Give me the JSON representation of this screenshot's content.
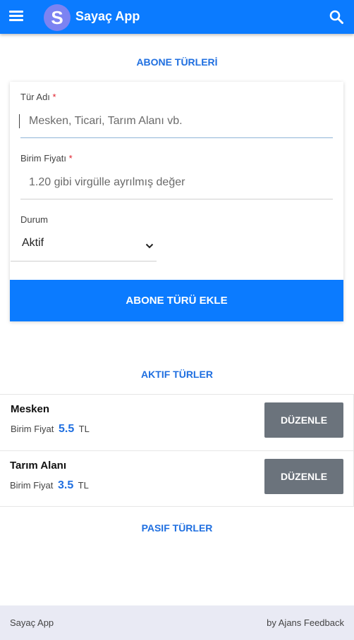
{
  "appbar": {
    "title": "Sayaç App",
    "logo_letter": "S",
    "menu_icon": "hamburger-menu-icon",
    "search_icon": "search-icon",
    "background": "#0b7bff"
  },
  "subscriber_types": {
    "heading": "ABONE TÜRLERİ"
  },
  "form": {
    "type_name": {
      "label": "Tür Adı",
      "required_mark": "*",
      "value": "",
      "placeholder": "Mesken, Ticari, Tarım Alanı vb."
    },
    "unit_price": {
      "label": "Birim Fiyatı",
      "required_mark": "*",
      "value": "",
      "placeholder": "1.20 gibi virgülle ayrılmış değer"
    },
    "status": {
      "label": "Durum",
      "selected": "Aktif"
    },
    "submit_label": "ABONE TÜRÜ EKLE"
  },
  "active_types": {
    "heading": "AKTIF TÜRLER",
    "items": [
      {
        "name": "Mesken",
        "price_label": "Birim Fiyat",
        "price": "5.5",
        "currency": "TL",
        "edit_label": "DÜZENLE"
      },
      {
        "name": "Tarım Alanı",
        "price_label": "Birim Fiyat",
        "price": "3.5",
        "currency": "TL",
        "edit_label": "DÜZENLE"
      }
    ]
  },
  "passive_types": {
    "heading": "PASIF TÜRLER"
  },
  "footer": {
    "left": "Sayaç App",
    "right": "by Ajans Feedback"
  },
  "colors": {
    "accent": "#0b7bff",
    "link": "#1f6fe0",
    "edit_button": "#6b737c",
    "footer_bg": "#e9eaf4",
    "required": "#e0202c"
  }
}
